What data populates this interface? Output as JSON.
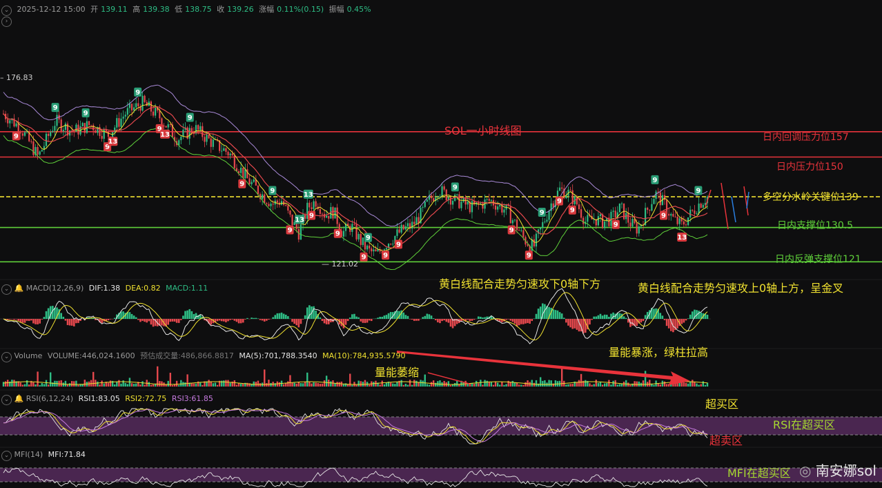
{
  "header": {
    "datetime": "2025-12-12 15:00",
    "open_label": "开",
    "open": "139.11",
    "high_label": "高",
    "high": "139.38",
    "low_label": "低",
    "low": "138.75",
    "close_label": "收",
    "close": "139.26",
    "change_label": "涨幅",
    "change": "0.11%(0.15)",
    "amplitude_label": "振幅",
    "amplitude": "0.45%"
  },
  "main": {
    "high_marker": "176.83",
    "low_marker": "121.02",
    "title_annotation": "SOL一小时线图",
    "levels": [
      {
        "label": "日内回调压力位157",
        "value": 157,
        "color": "#e8333b"
      },
      {
        "label": "日内压力位150",
        "value": 150,
        "color": "#e8333b"
      },
      {
        "label": "多空分水岭关键位139",
        "value": 139,
        "color": "#f0e130"
      },
      {
        "label": "日内支撑位130.5",
        "value": 130.5,
        "color": "#5fd03a"
      },
      {
        "label": "日内反弹支撑位121",
        "value": 121,
        "color": "#5fd03a"
      }
    ],
    "td_counts": [
      "9",
      "13"
    ]
  },
  "macd": {
    "name": "MACD(12,26,9)",
    "dif_label": "DIF:1.38",
    "dea_label": "DEA:0.82",
    "macd_label": "MACD:1.11",
    "anno1": "黄白线配合走势匀速攻下0轴下方",
    "anno2": "黄白线配合走势匀速攻上0轴上方，呈金叉"
  },
  "volume": {
    "name": "Volume",
    "volume_label": "VOLUME:446,024.1600",
    "est_label": "预估成交量:486,866.8817",
    "ma5_label": "MA(5):701,788.3540",
    "ma10_label": "MA(10):784,935.5790",
    "anno1": "量能萎缩",
    "anno2": "量能暴涨，绿柱拉高"
  },
  "rsi": {
    "name": "RSI(6,12,24)",
    "rsi1": "RSI1:83.05",
    "rsi2": "RSI2:72.75",
    "rsi3": "RSI3:61.85",
    "overbought": "超买区",
    "oversold": "超卖区",
    "anno": "RSI在超买区"
  },
  "mfi": {
    "name": "MFI(14)",
    "value": "MFI:71.84",
    "anno": "MFI在超买区"
  },
  "watermark": "南安娜sol",
  "colors": {
    "up": "#2ebd85",
    "down": "#e5484d",
    "yellow": "#f0e130",
    "purple": "#a98ad8",
    "green_line": "#5fd03a",
    "red_line": "#e8333b",
    "band": "#4a2650"
  },
  "chart_data": {
    "type": "candlestick",
    "y_range": [
      118,
      182
    ],
    "price_path": [
      [
        0,
        162
      ],
      [
        4,
        158
      ],
      [
        8,
        150
      ],
      [
        12,
        160
      ],
      [
        16,
        157
      ],
      [
        20,
        159
      ],
      [
        24,
        156
      ],
      [
        28,
        162
      ],
      [
        32,
        165
      ],
      [
        36,
        161
      ],
      [
        40,
        155
      ],
      [
        44,
        158
      ],
      [
        48,
        154
      ],
      [
        52,
        151
      ],
      [
        56,
        144
      ],
      [
        60,
        139
      ],
      [
        62,
        137
      ],
      [
        64,
        138
      ],
      [
        66,
        133
      ],
      [
        68,
        129
      ],
      [
        70,
        136
      ],
      [
        72,
        138
      ],
      [
        74,
        134
      ],
      [
        76,
        135
      ],
      [
        78,
        129
      ],
      [
        80,
        131
      ],
      [
        82,
        127
      ],
      [
        84,
        124
      ],
      [
        86,
        123
      ],
      [
        88,
        126
      ],
      [
        90,
        128
      ],
      [
        92,
        130
      ],
      [
        94,
        131
      ],
      [
        96,
        134
      ],
      [
        98,
        138
      ],
      [
        100,
        141
      ],
      [
        104,
        138
      ],
      [
        108,
        136
      ],
      [
        112,
        138
      ],
      [
        116,
        135
      ],
      [
        118,
        131
      ],
      [
        120,
        127
      ],
      [
        122,
        125
      ],
      [
        124,
        131
      ],
      [
        126,
        137
      ],
      [
        128,
        141
      ],
      [
        130,
        140
      ],
      [
        132,
        137
      ],
      [
        134,
        132
      ],
      [
        136,
        133
      ],
      [
        138,
        132
      ],
      [
        140,
        133
      ],
      [
        142,
        136
      ],
      [
        144,
        132
      ],
      [
        146,
        130
      ],
      [
        148,
        135
      ],
      [
        150,
        140
      ],
      [
        152,
        137
      ],
      [
        154,
        133
      ],
      [
        156,
        131
      ],
      [
        158,
        134
      ],
      [
        160,
        137
      ],
      [
        162,
        139
      ]
    ],
    "series": [
      {
        "name": "MACD",
        "dif": 1.38,
        "dea": 0.82,
        "macd": 1.11
      },
      {
        "name": "RSI",
        "rsi1": 83.05,
        "rsi2": 72.75,
        "rsi3": 61.85
      },
      {
        "name": "MFI",
        "mfi": 71.84
      }
    ]
  }
}
